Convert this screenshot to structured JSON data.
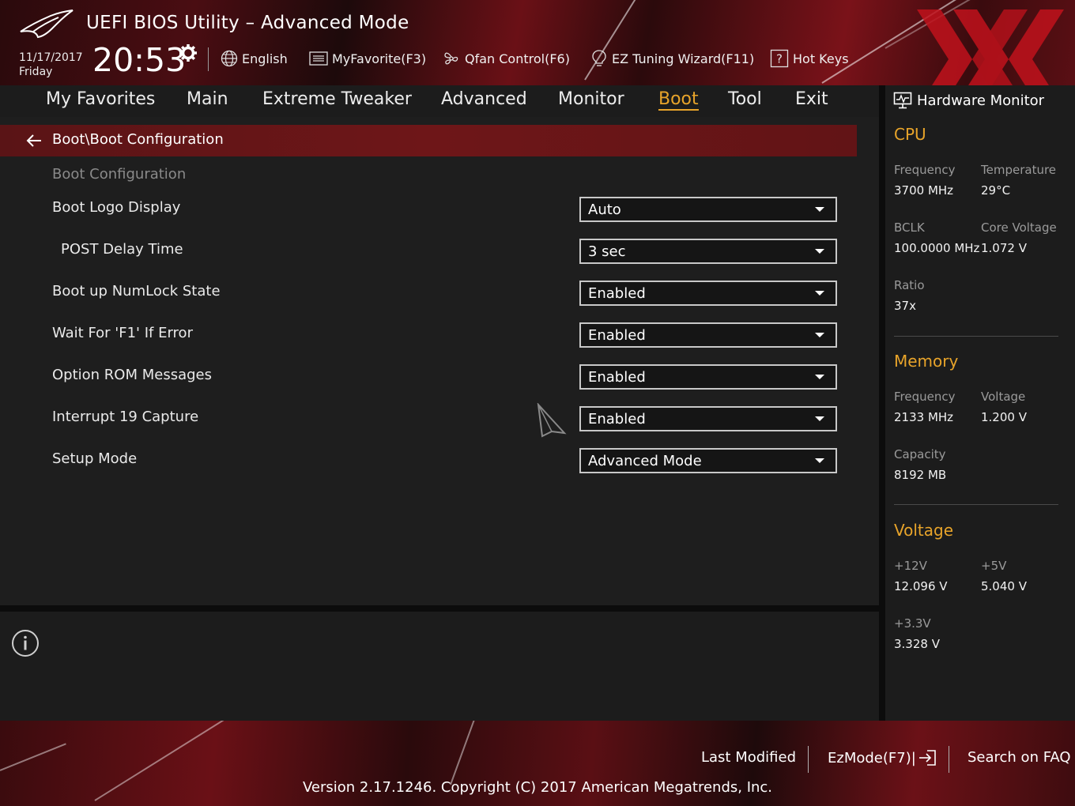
{
  "header": {
    "title": "UEFI BIOS Utility – Advanced Mode",
    "date": "11/17/2017",
    "weekday": "Friday",
    "time": "20:53",
    "tools": [
      {
        "label": "English",
        "icon": "globe-icon"
      },
      {
        "label": "MyFavorite(F3)",
        "icon": "favorite-list-icon"
      },
      {
        "label": "Qfan Control(F6)",
        "icon": "fan-icon"
      },
      {
        "label": "EZ Tuning Wizard(F11)",
        "icon": "lightbulb-icon"
      },
      {
        "label": "Hot Keys",
        "icon": "question-icon"
      }
    ]
  },
  "nav": {
    "tabs": [
      "My Favorites",
      "Main",
      "Extreme Tweaker",
      "Advanced",
      "Monitor",
      "Boot",
      "Tool",
      "Exit"
    ],
    "active": "Boot"
  },
  "breadcrumb": "Boot\\Boot Configuration",
  "section_title": "Boot Configuration",
  "settings": [
    {
      "label": "Boot Logo Display",
      "value": "Auto"
    },
    {
      "label": "POST Delay Time",
      "value": "3 sec"
    },
    {
      "label": "Boot up NumLock State",
      "value": "Enabled"
    },
    {
      "label": "Wait For 'F1' If Error",
      "value": "Enabled"
    },
    {
      "label": "Option ROM Messages",
      "value": "Enabled"
    },
    {
      "label": "Interrupt 19 Capture",
      "value": "Enabled"
    },
    {
      "label": "Setup Mode",
      "value": "Advanced Mode"
    }
  ],
  "hardware_monitor": {
    "title": "Hardware Monitor",
    "cpu": {
      "title": "CPU",
      "frequency_label": "Frequency",
      "frequency": "3700 MHz",
      "temperature_label": "Temperature",
      "temperature": "29°C",
      "bclk_label": "BCLK",
      "bclk": "100.0000 MHz",
      "core_voltage_label": "Core Voltage",
      "core_voltage": "1.072 V",
      "ratio_label": "Ratio",
      "ratio": "37x"
    },
    "memory": {
      "title": "Memory",
      "frequency_label": "Frequency",
      "frequency": "2133 MHz",
      "voltage_label": "Voltage",
      "voltage": "1.200 V",
      "capacity_label": "Capacity",
      "capacity": "8192 MB"
    },
    "voltage": {
      "title": "Voltage",
      "v12_label": "+12V",
      "v12": "12.096 V",
      "v5_label": "+5V",
      "v5": "5.040 V",
      "v33_label": "+3.3V",
      "v33": "3.328 V"
    }
  },
  "footer": {
    "last_modified": "Last Modified",
    "ezmode": "EzMode(F7)|",
    "search_faq": "Search on FAQ",
    "version": "Version 2.17.1246. Copyright (C) 2017 American Megatrends, Inc."
  },
  "colors": {
    "accent": "#e8a42a",
    "breadcrumb_bg": "#6e1618",
    "panel_bg": "#1c1c1c"
  }
}
